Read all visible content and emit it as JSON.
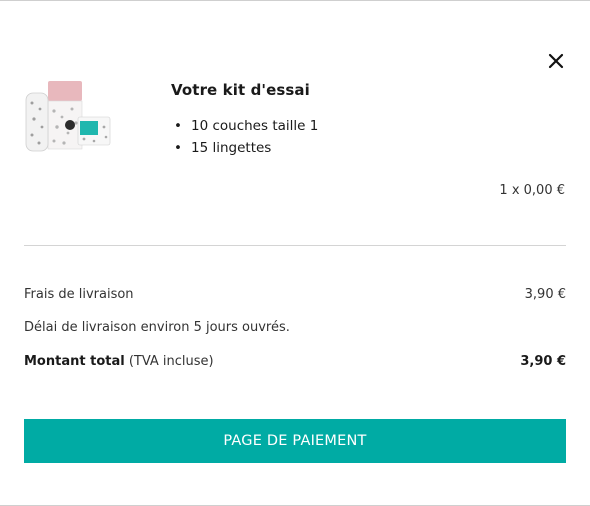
{
  "product": {
    "title": "Votre kit d'essai",
    "items": [
      "10 couches taille 1",
      "15 lingettes"
    ],
    "unit_price": "1 x 0,00 €",
    "image_icon": "diaper-kit-image"
  },
  "summary": {
    "shipping_label": "Frais de livraison",
    "shipping_value": "3,90 €",
    "delivery_note": "Délai de livraison environ 5 jours ouvrés.",
    "total_label": "Montant total",
    "total_suffix": " (TVA incluse)",
    "total_value": "3,90 €"
  },
  "actions": {
    "pay_label": "PAGE DE PAIEMENT",
    "close_icon": "close-icon"
  },
  "colors": {
    "accent": "#00aba4",
    "text": "#1a1a1a",
    "divider": "#d4d4d4"
  }
}
